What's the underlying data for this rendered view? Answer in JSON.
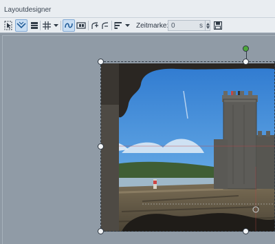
{
  "window": {
    "title": "Layoutdesigner"
  },
  "toolbar": {
    "tools": [
      {
        "name": "select-tool-icon",
        "active": false
      },
      {
        "name": "hand-down-icon",
        "active": true
      },
      {
        "name": "layers-icon",
        "active": false
      },
      {
        "name": "grid-icon",
        "active": false
      },
      {
        "name": "dropdown-arrow-icon",
        "active": false
      },
      {
        "name": "curve-path-icon",
        "active": true
      },
      {
        "name": "camera-keyframe-icon",
        "active": false
      },
      {
        "name": "keyframe-add-icon",
        "active": false
      },
      {
        "name": "keyframe-curve-icon",
        "active": false
      },
      {
        "name": "align-icon",
        "active": false
      },
      {
        "name": "align-dropdown-icon",
        "active": false
      }
    ],
    "zeitmarke_label": "Zeitmarke:",
    "zeitmarke_value": "0",
    "zeitmarke_unit": "s",
    "save_icon": "save-icon"
  },
  "colors": {
    "workspace": "#909ba6",
    "accent_active": "#c9def3",
    "rotation_handle": "#4ea83b"
  }
}
